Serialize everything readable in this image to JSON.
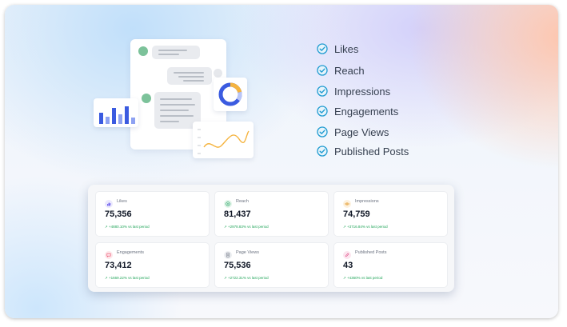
{
  "checklist": [
    {
      "label": "Likes",
      "icon": "check-circle-icon"
    },
    {
      "label": "Reach",
      "icon": "check-circle-icon"
    },
    {
      "label": "Impressions",
      "icon": "check-circle-icon"
    },
    {
      "label": "Engagements",
      "icon": "check-circle-icon"
    },
    {
      "label": "Page Views",
      "icon": "check-circle-icon"
    },
    {
      "label": "Published Posts",
      "icon": "check-circle-icon"
    }
  ],
  "stats": [
    {
      "label": "Likes",
      "value": "75,356",
      "change": "↗ +4880.10% vs last period",
      "icon": "thumbs-up-icon",
      "color": "#7c6ff0",
      "bg": "#ebe9fd"
    },
    {
      "label": "Reach",
      "value": "81,437",
      "change": "↗ +2978.83% vs last period",
      "icon": "target-icon",
      "color": "#2fa86a",
      "bg": "#e3f5ea"
    },
    {
      "label": "Impressions",
      "value": "74,759",
      "change": "↗ +3716.84% vs last period",
      "icon": "eye-icon",
      "color": "#e6a23c",
      "bg": "#fdf1de"
    },
    {
      "label": "Engagements",
      "value": "73,412",
      "change": "↗ +1669.22% vs last period",
      "icon": "chat-bubble-icon",
      "color": "#ec4f6e",
      "bg": "#fde6ea"
    },
    {
      "label": "Page Views",
      "value": "75,536",
      "change": "↗ +2722.31% vs last period",
      "icon": "document-icon",
      "color": "#6b7280",
      "bg": "#eceef1"
    },
    {
      "label": "Published Posts",
      "value": "43",
      "change": "↗ +4360% vs last period",
      "icon": "post-icon",
      "color": "#e0558a",
      "bg": "#fce5ef"
    }
  ],
  "colors": {
    "check": "#1f9bd1",
    "accent_blue": "#4f6bed",
    "accent_orange": "#f5b440"
  }
}
